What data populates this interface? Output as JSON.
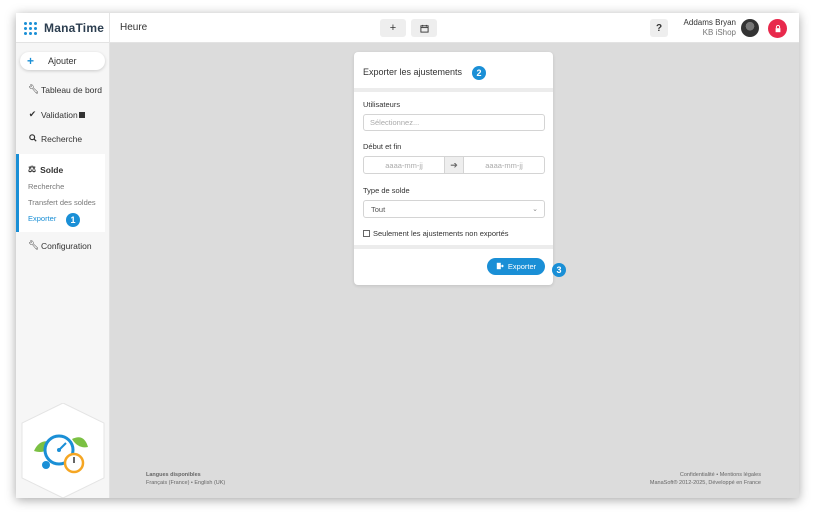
{
  "app": {
    "name": "ManaTime",
    "page_title": "Heure"
  },
  "header": {
    "add_label": "+",
    "calendar_icon": "calendar-icon",
    "help_label": "?",
    "user_name": "Addams Bryan",
    "user_company": "KB iShop"
  },
  "sidebar": {
    "add_label": "Ajouter",
    "items": [
      {
        "label": "Tableau de bord",
        "icon": "wrench-icon"
      },
      {
        "label": "Validation",
        "icon": "check-icon"
      },
      {
        "label": "Recherche",
        "icon": "search-icon"
      },
      {
        "label": "Configuration",
        "icon": "wrench-icon"
      }
    ],
    "solde": {
      "title": "Solde",
      "subitems": [
        "Recherche",
        "Transfert des soldes",
        "Exporter"
      ]
    }
  },
  "badges": [
    "1",
    "2",
    "3"
  ],
  "panel": {
    "title": "Exporter les ajustements",
    "users_label": "Utilisateurs",
    "users_placeholder": "Sélectionnez...",
    "range_label": "Début et fin",
    "start_placeholder": "aaaa-mm-jj",
    "end_placeholder": "aaaa-mm-jj",
    "type_label": "Type de solde",
    "type_value": "Tout",
    "checkbox_label": "Seulement les ajustements non exportés",
    "export_label": "Exporter"
  },
  "footer": {
    "languages_title": "Langues disponibles",
    "languages": "Français (France) • English (UK)",
    "links": "Confidentialité • Mentions légales",
    "copyright": "ManaSoft® 2012-2025, Développé en France"
  },
  "colors": {
    "accent": "#1a8fd6",
    "logout": "#e8294c",
    "background": "#dcdcdc"
  }
}
